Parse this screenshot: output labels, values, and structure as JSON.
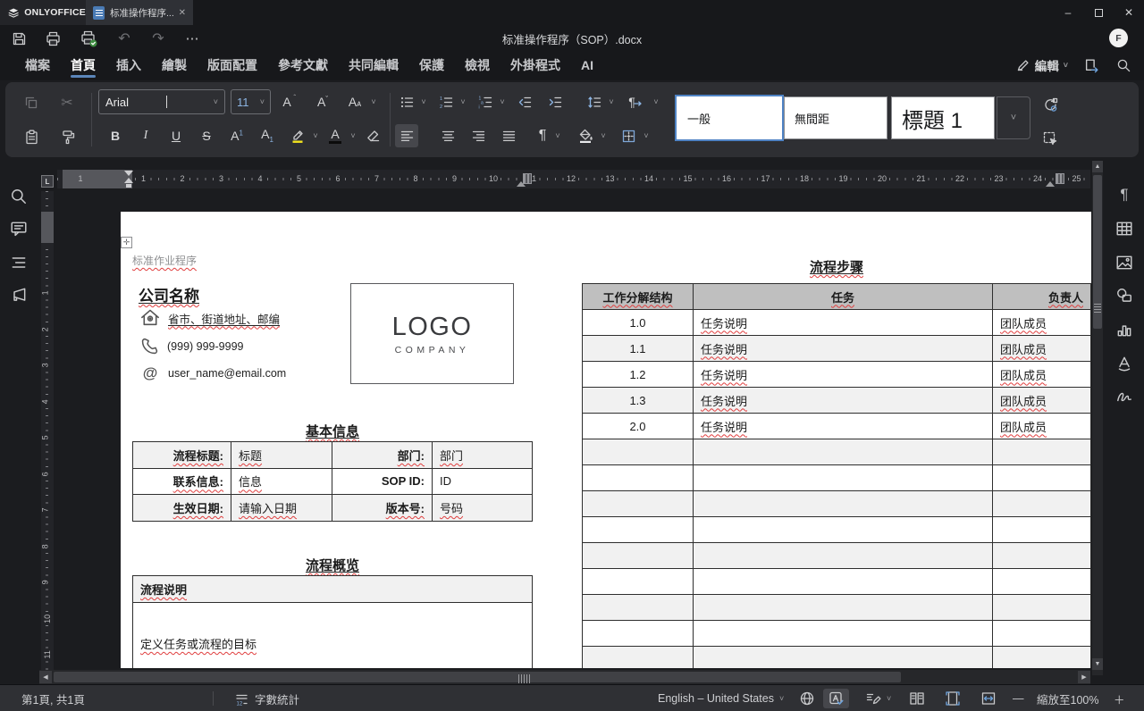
{
  "window": {
    "app": "ONLYOFFICE",
    "tab": "标准操作程序...",
    "title": "标准操作程序（SOP）.docx",
    "avatar": "F"
  },
  "icons": {
    "undo": "↶",
    "redo": "↷",
    "more": "⋯",
    "cut": "✂",
    "pilcrow": "¶",
    "chevron_down": "˅",
    "up_arrow": "▲",
    "down_arrow": "▼",
    "left_arrow": "◀",
    "right_arrow": "▶",
    "minimize": "–",
    "close": "✕",
    "move_handle": "✛",
    "minus": "—",
    "plus": "＋",
    "at_sign": "@"
  },
  "menu": {
    "items": [
      "檔案",
      "首頁",
      "插入",
      "繪製",
      "版面配置",
      "參考文獻",
      "共同編輯",
      "保護",
      "檢視",
      "外掛程式",
      "AI"
    ],
    "active_index": 1,
    "edit": "編輯"
  },
  "toolbar": {
    "font": "Arial",
    "size": "11",
    "bold": "B",
    "italic": "I",
    "underline": "U",
    "strike": "S",
    "styles": [
      "一般",
      "無間距",
      "標題 1"
    ],
    "selected_style_index": 0
  },
  "rulers": {
    "h_numbers": [
      1,
      2,
      3,
      4,
      5,
      6,
      7,
      8,
      9,
      10,
      11,
      12,
      13,
      14,
      15,
      16,
      17,
      18,
      19,
      20,
      21,
      22,
      23,
      24,
      25
    ],
    "h_margin_number": "1",
    "v_numbers": [
      1,
      2,
      3,
      4,
      5,
      6,
      7,
      8,
      9,
      10,
      11
    ],
    "corner": "L"
  },
  "document": {
    "tag": "标准作业程序",
    "company": {
      "name": "公司名称",
      "address": "省市、街道地址、邮编",
      "phone": "(999) 999-9999",
      "email": "user_name@email.com"
    },
    "logo": {
      "top": "LOGO",
      "bottom": "COMPANY"
    },
    "basic_info": {
      "title": "基本信息",
      "rows": [
        [
          "流程标题:",
          "标题",
          "部门:",
          "部门"
        ],
        [
          "联系信息:",
          "信息",
          "SOP ID:",
          "ID"
        ],
        [
          "生效日期:",
          "请输入日期",
          "版本号:",
          "号码"
        ]
      ]
    },
    "overview": {
      "title": "流程概览",
      "header": "流程说明",
      "body": "定义任务或流程的目标"
    },
    "steps": {
      "title": "流程步骤",
      "headers": [
        "工作分解结构",
        "任务",
        "负责人"
      ],
      "rows": [
        [
          "1.0",
          "任务说明",
          "团队成员"
        ],
        [
          "1.1",
          "任务说明",
          "团队成员"
        ],
        [
          "1.2",
          "任务说明",
          "团队成员"
        ],
        [
          "1.3",
          "任务说明",
          "团队成员"
        ],
        [
          "2.0",
          "任务说明",
          "团队成员"
        ]
      ],
      "empty_rows": 9
    }
  },
  "statusbar": {
    "page": "第1頁, 共1頁",
    "words": "字數統計",
    "lang": "English – United States",
    "zoom": "縮放至100%"
  },
  "colors": {
    "accent": "#5b86ba",
    "band": "#f1f1f1",
    "steps_header": "#bfbfbf",
    "squiggle": "#e03e3e",
    "highlight": "#f3e41f"
  }
}
